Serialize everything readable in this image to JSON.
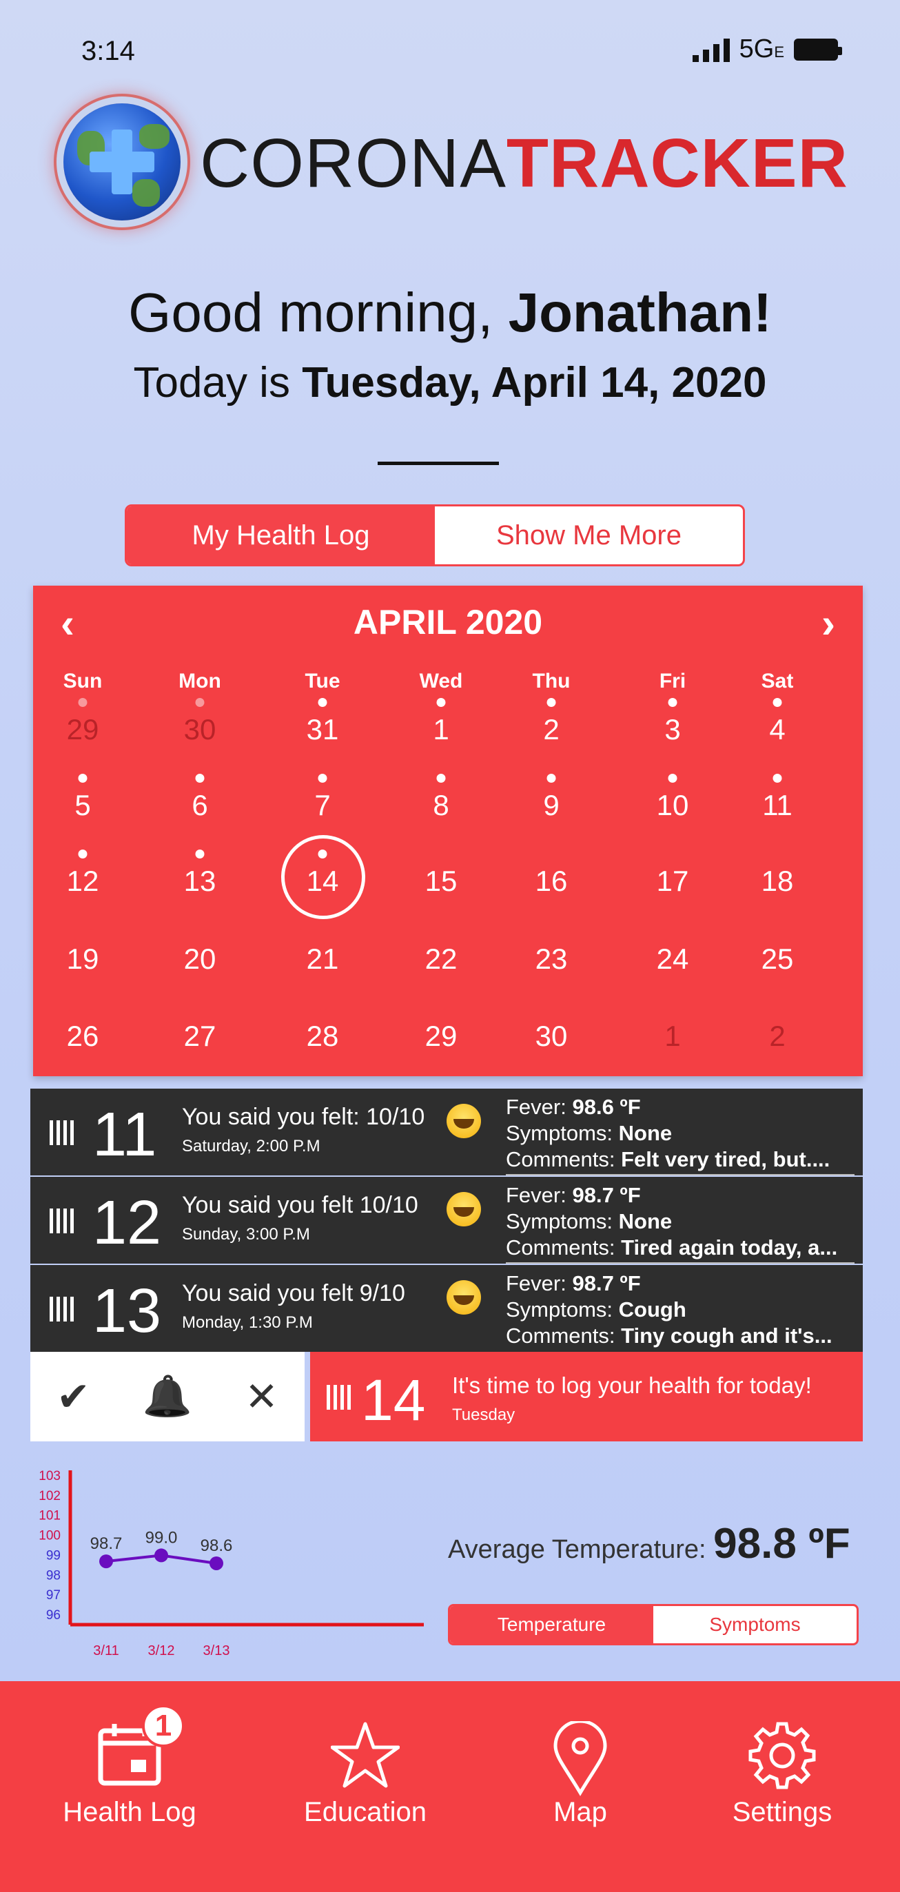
{
  "status_bar": {
    "time": "3:14",
    "network": "5G",
    "network_sub": "E"
  },
  "brand": {
    "part1": "CORONA",
    "part2": "TRACKER"
  },
  "greeting": {
    "prefix": "Good morning, ",
    "name": "Jonathan!"
  },
  "today": {
    "prefix": "Today is ",
    "date": "Tuesday, April 14, 2020"
  },
  "segment": {
    "active": "My Health Log",
    "inactive": "Show Me More"
  },
  "calendar": {
    "month": "APRIL 2020",
    "prev": "‹",
    "next": "›",
    "weekdays": [
      "Sun",
      "Mon",
      "Tue",
      "Wed",
      "Thu",
      "Fri",
      "Sat"
    ],
    "weeks": [
      [
        "29",
        "30",
        "31",
        "1",
        "2",
        "3",
        "4"
      ],
      [
        "5",
        "6",
        "7",
        "8",
        "9",
        "10",
        "11"
      ],
      [
        "12",
        "13",
        "14",
        "15",
        "16",
        "17",
        "18"
      ],
      [
        "19",
        "20",
        "21",
        "22",
        "23",
        "24",
        "25"
      ],
      [
        "26",
        "27",
        "28",
        "29",
        "30",
        "1",
        "2"
      ]
    ],
    "selected": "14"
  },
  "logs": [
    {
      "day": "11",
      "felt": "You said you felt: 10/10",
      "when": "Saturday, 2:00 P.M",
      "fever": "98.6 ºF",
      "symptoms": "None",
      "comments": "Felt very tired, but...."
    },
    {
      "day": "12",
      "felt": "You said you felt 10/10",
      "when": "Sunday, 3:00 P.M",
      "fever": "98.7 ºF",
      "symptoms": "None",
      "comments": "Tired again today, a..."
    },
    {
      "day": "13",
      "felt": "You said you felt   9/10",
      "when": "Monday, 1:30 P.M",
      "fever": "98.7 ºF",
      "symptoms": "Cough",
      "comments": "Tiny cough and it's..."
    }
  ],
  "log_labels": {
    "fever": "Fever: ",
    "symptoms": "Symptoms: ",
    "comments": "Comments: "
  },
  "swipe_actions": {
    "check": "✔",
    "bell": "🔔",
    "close": "✕"
  },
  "reminder": {
    "day": "14",
    "message": "It's time to log your health for today!",
    "weekday": "Tuesday"
  },
  "chart_data": {
    "type": "line",
    "categories": [
      "3/11",
      "3/12",
      "3/13"
    ],
    "values": [
      98.7,
      99.0,
      98.6
    ],
    "data_labels": [
      "98.7",
      "99.0",
      "98.6"
    ],
    "y_ticks": [
      "103",
      "102",
      "101",
      "100",
      "99",
      "98",
      "97",
      "96"
    ],
    "ylim": [
      96,
      103
    ],
    "colors": {
      "line": "#6a0dbf",
      "axis": "#e2141b"
    }
  },
  "average": {
    "label": "Average Temperature: ",
    "value": "98.8 ºF"
  },
  "chart_toggle": {
    "active": "Temperature",
    "inactive": "Symptoms"
  },
  "tabbar": {
    "items": [
      {
        "label": "Health Log",
        "icon": "calendar-icon",
        "badge": "1"
      },
      {
        "label": "Education",
        "icon": "star-icon"
      },
      {
        "label": "Map",
        "icon": "map-pin-icon"
      },
      {
        "label": "Settings",
        "icon": "gear-icon"
      }
    ]
  },
  "colors": {
    "accent": "#f43f44",
    "dark_row": "#2e2e2e",
    "background": "#c5d2f7"
  }
}
